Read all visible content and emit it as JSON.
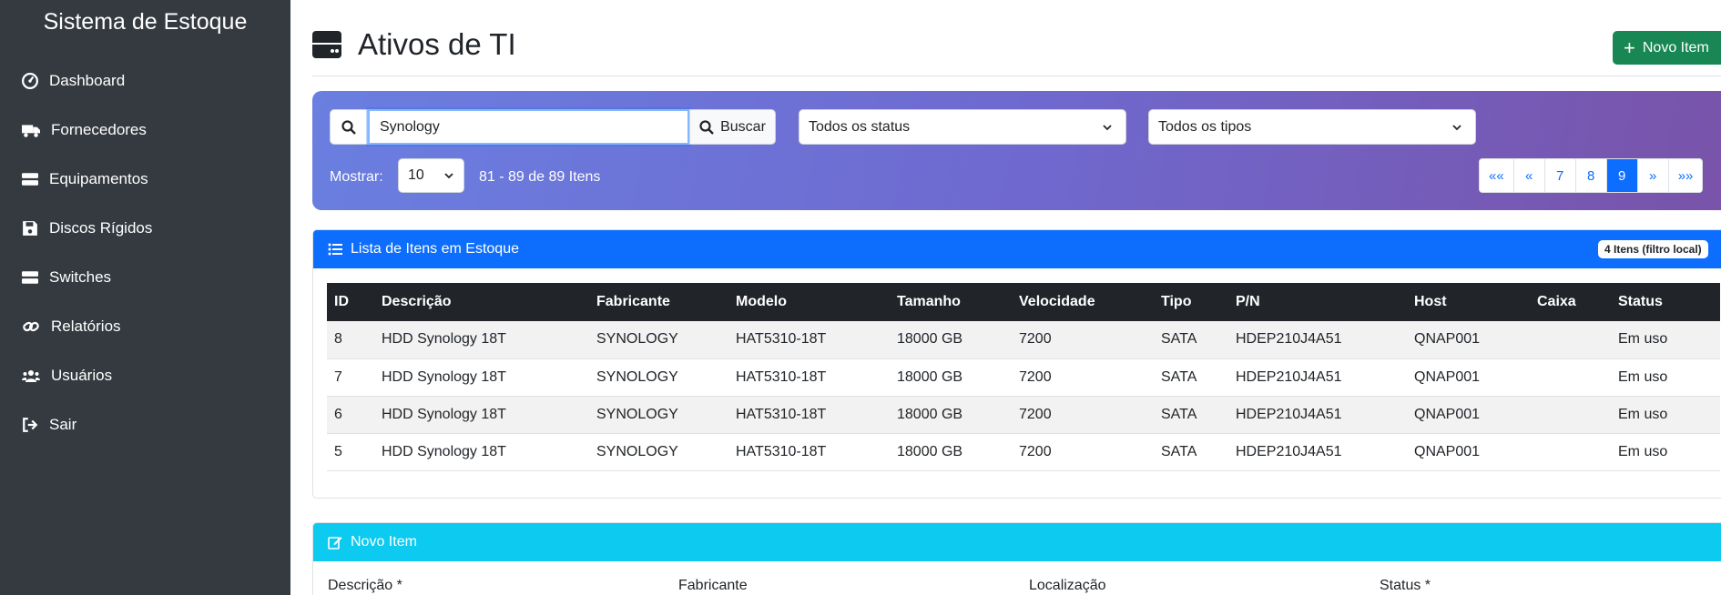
{
  "sidebar": {
    "brand": "Sistema de Estoque",
    "items": [
      {
        "label": "Dashboard",
        "icon": "dashboard-icon"
      },
      {
        "label": "Fornecedores",
        "icon": "truck-icon"
      },
      {
        "label": "Equipamentos",
        "icon": "server-icon"
      },
      {
        "label": "Discos Rígidos",
        "icon": "floppy-icon"
      },
      {
        "label": "Switches",
        "icon": "switch-icon"
      },
      {
        "label": "Relatórios",
        "icon": "link-icon"
      },
      {
        "label": "Usuários",
        "icon": "users-icon"
      },
      {
        "label": "Sair",
        "icon": "logout-icon"
      }
    ]
  },
  "header": {
    "title": "Ativos de TI",
    "new_button": "Novo Item"
  },
  "filters": {
    "search_value": "Synology",
    "search_button": "Buscar",
    "status_select": "Todos os status",
    "type_select": "Todos os tipos",
    "show_label": "Mostrar:",
    "page_size": "10",
    "range_text": "81 - 89 de 89 Itens"
  },
  "pagination": {
    "items": [
      "««",
      "«",
      "7",
      "8",
      "9",
      "»",
      "»»"
    ],
    "active": "9"
  },
  "list": {
    "title": "Lista de Itens em Estoque",
    "badge": "4 Itens (filtro local)",
    "columns": [
      "ID",
      "Descrição",
      "Fabricante",
      "Modelo",
      "Tamanho",
      "Velocidade",
      "Tipo",
      "P/N",
      "Host",
      "Caixa",
      "Status"
    ],
    "rows": [
      [
        "8",
        "HDD Synology 18T",
        "SYNOLOGY",
        "HAT5310-18T",
        "18000 GB",
        "7200",
        "SATA",
        "HDEP210J4A51",
        "QNAP001",
        "",
        "Em uso"
      ],
      [
        "7",
        "HDD Synology 18T",
        "SYNOLOGY",
        "HAT5310-18T",
        "18000 GB",
        "7200",
        "SATA",
        "HDEP210J4A51",
        "QNAP001",
        "",
        "Em uso"
      ],
      [
        "6",
        "HDD Synology 18T",
        "SYNOLOGY",
        "HAT5310-18T",
        "18000 GB",
        "7200",
        "SATA",
        "HDEP210J4A51",
        "QNAP001",
        "",
        "Em uso"
      ],
      [
        "5",
        "HDD Synology 18T",
        "SYNOLOGY",
        "HAT5310-18T",
        "18000 GB",
        "7200",
        "SATA",
        "HDEP210J4A51",
        "QNAP001",
        "",
        "Em uso"
      ]
    ]
  },
  "new_item": {
    "title": "Novo Item",
    "fields": [
      "Descrição *",
      "Fabricante",
      "Localização",
      "Status *"
    ]
  },
  "colors": {
    "sidebar_bg": "#343a40",
    "primary": "#0d6efd",
    "success": "#198754",
    "info": "#0dcaf0",
    "table_header": "#212529"
  }
}
